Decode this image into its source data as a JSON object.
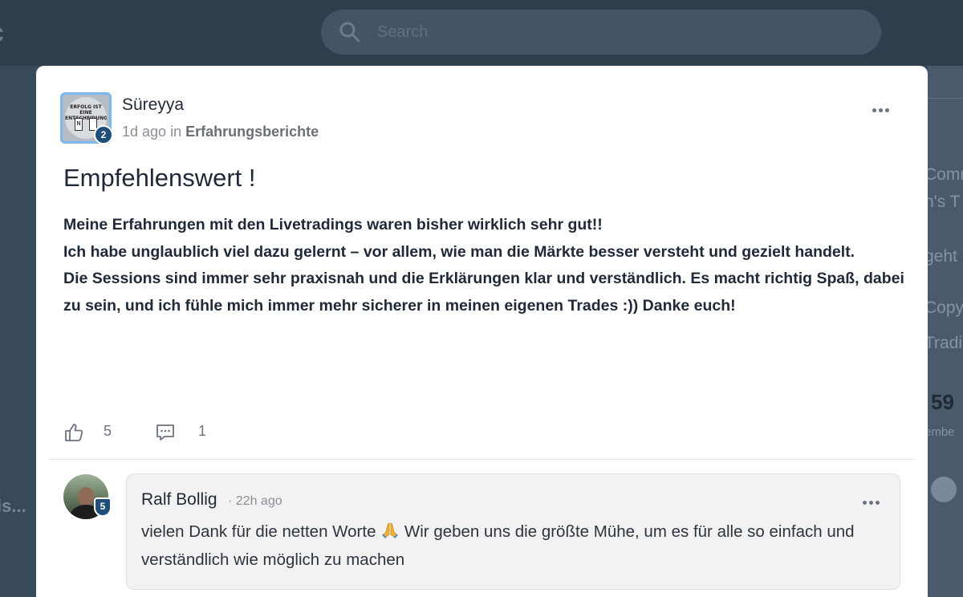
{
  "background": {
    "search_placeholder": "Search",
    "left_truncated_text": "is...",
    "right_panel_fragments": [
      "Comm",
      "h's T",
      "geht",
      "Copy",
      "Tradi"
    ],
    "right_panel_number": "59",
    "right_panel_number_label": "embe"
  },
  "post": {
    "author": "Süreyya",
    "author_level": "2",
    "avatar_caption": "ERFOLG IST EINE ENTSCHEIDUNG",
    "avatar_sign_letter": "N",
    "posted_ago": "1d ago",
    "in_label": "in",
    "category": "Erfahrungsberichte",
    "title": "Empfehlenswert !",
    "body": [
      "Meine Erfahrungen mit den Livetradings waren bisher wirklich sehr gut!!",
      "Ich habe unglaublich viel dazu gelernt – vor allem, wie man die Märkte besser versteht und gezielt handelt.",
      "Die Sessions sind immer sehr praxisnah und die Erklärungen klar und verständlich. Es macht richtig Spaß, dabei zu sein, und ich fühle mich immer mehr sicherer in meinen eigenen Trades :)) Danke euch!"
    ],
    "likes": "5",
    "comments": "1"
  },
  "comment": {
    "author": "Ralf Bollig",
    "author_level": "5",
    "time": "· 22h ago",
    "text_before_emoji": "vielen Dank für die netten Worte",
    "emoji": "praying-hands",
    "text_after_emoji": "Wir geben uns die größte Mühe, um es für alle so einfach und verständlich wie möglich zu machen"
  },
  "colors": {
    "overlay": "#38495c",
    "level_badge": "#1f4e79",
    "avatar_border": "#7ab8ef",
    "comment_bg": "#f2f2f2"
  }
}
